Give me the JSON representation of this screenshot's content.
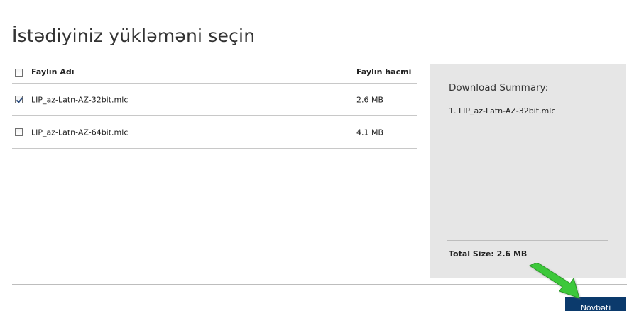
{
  "page": {
    "title": "İstədiyiniz yükləməni seçin"
  },
  "table": {
    "header": {
      "name": "Faylın Adı",
      "size": "Faylın həcmi",
      "checked": false
    },
    "rows": [
      {
        "name": "LIP_az-Latn-AZ-32bit.mlc",
        "size": "2.6 MB",
        "checked": true
      },
      {
        "name": "LIP_az-Latn-AZ-64bit.mlc",
        "size": "4.1 MB",
        "checked": false
      }
    ]
  },
  "summary": {
    "heading": "Download Summary:",
    "items": [
      "1. LIP_az-Latn-AZ-32bit.mlc"
    ],
    "total": "Total Size: 2.6 MB"
  },
  "footer": {
    "next_label": "Növbəti"
  },
  "colors": {
    "summary_bg": "#e6e6e6",
    "button_bg": "#0b3a6c",
    "arrow": "#3dc83a"
  },
  "icons": {
    "pointer_arrow": "green-arrow-icon"
  }
}
